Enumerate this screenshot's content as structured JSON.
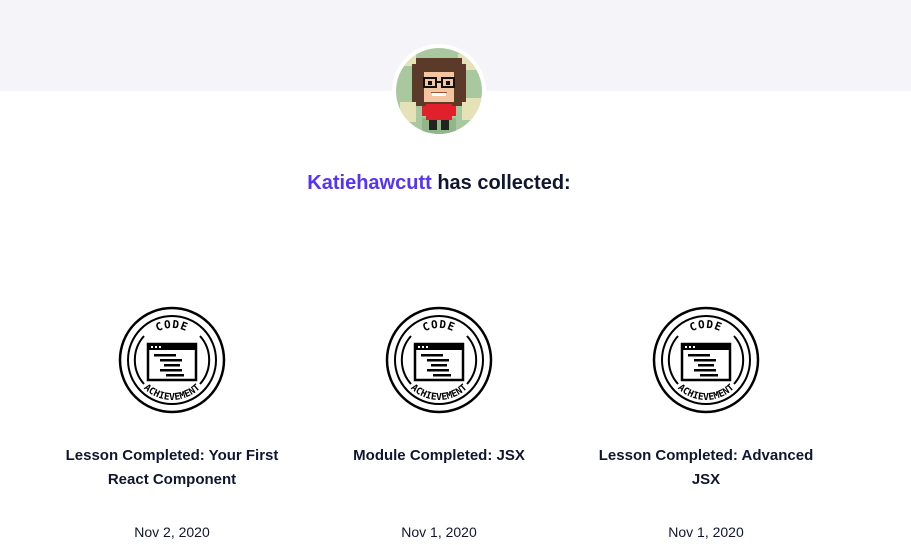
{
  "profile": {
    "username": "Katiehawcutt",
    "collected_text": " has collected:"
  },
  "badge_icon": {
    "top_text": "CODE",
    "bottom_text": "ACHIEVEMENT"
  },
  "badges": [
    {
      "title": "Lesson Completed: Your First React Component",
      "date": "Nov 2, 2020"
    },
    {
      "title": "Module Completed: JSX",
      "date": "Nov 1, 2020"
    },
    {
      "title": "Lesson Completed: Advanced JSX",
      "date": "Nov 1, 2020"
    }
  ],
  "colors": {
    "accent": "#5533ff",
    "text": "#10162f",
    "band": "#f5f5f9"
  }
}
